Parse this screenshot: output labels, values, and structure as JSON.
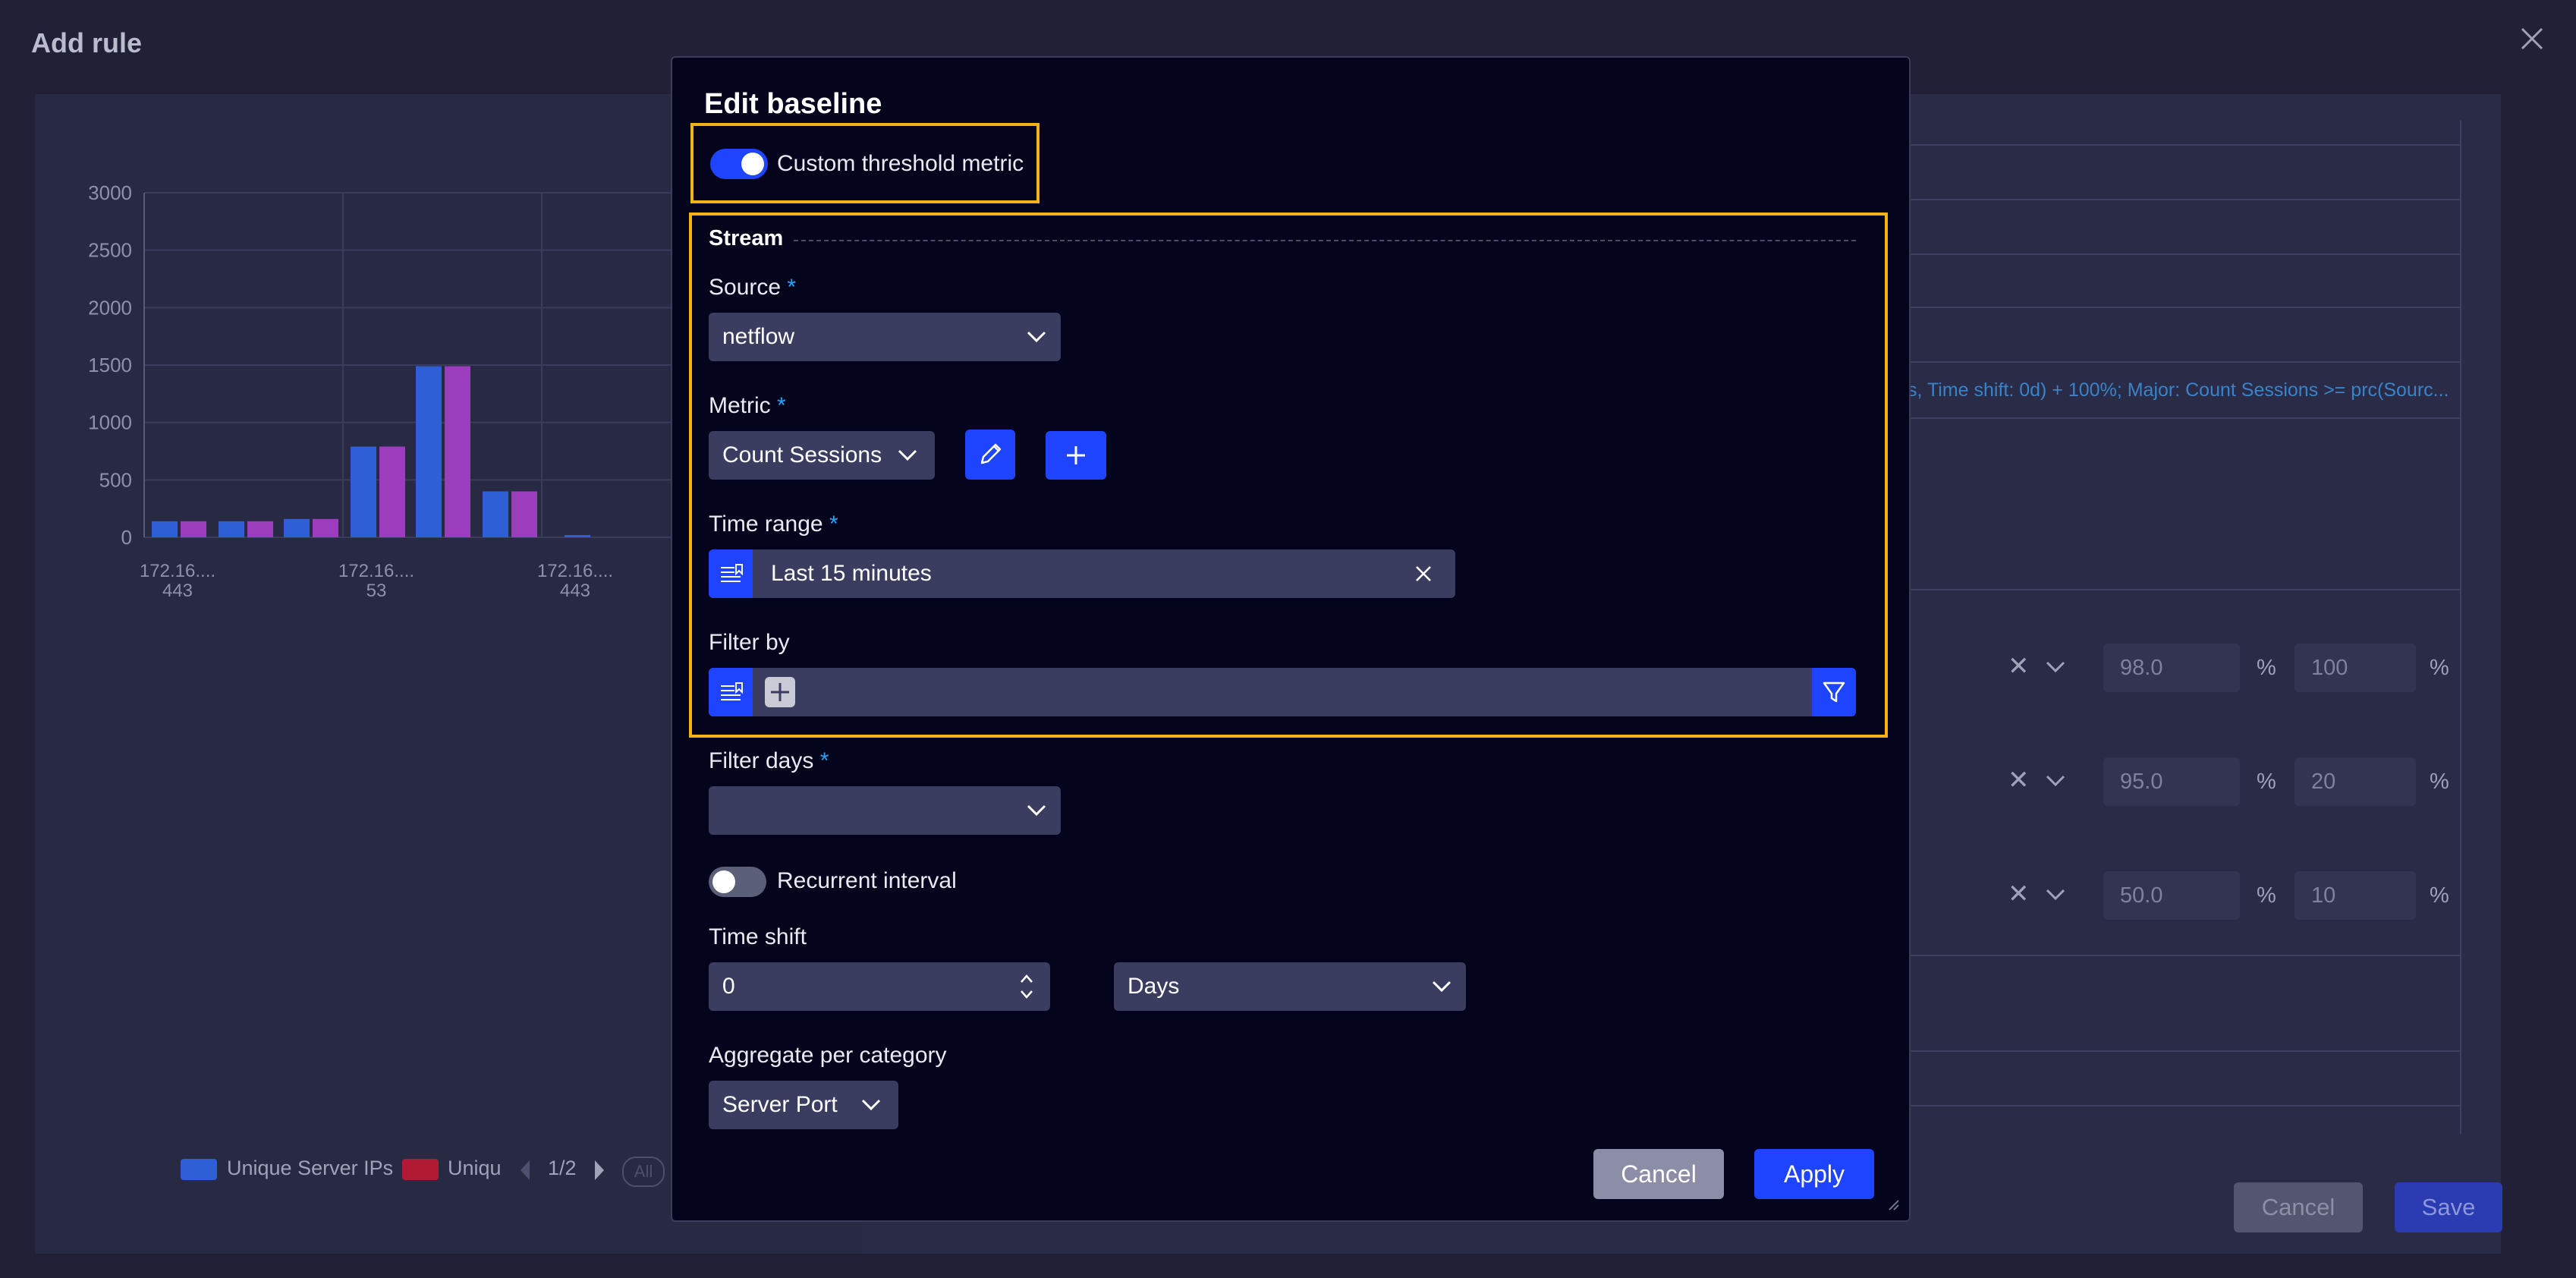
{
  "background": {
    "title": "Add rule",
    "rule_summary": "s, Time shift: 0d) + 100%; Major: Count Sessions >= prc(Sourc...",
    "thresholds": [
      {
        "low": "98.0",
        "high": "100",
        "unit": "%"
      },
      {
        "low": "95.0",
        "high": "20",
        "unit": "%"
      },
      {
        "low": "50.0",
        "high": "10",
        "unit": "%"
      }
    ],
    "cancel_label": "Cancel",
    "save_label": "Save"
  },
  "chart_data": {
    "type": "bar",
    "yticks": [
      "3000",
      "2500",
      "2000",
      "1500",
      "1000",
      "500",
      "0"
    ],
    "xticks": [
      {
        "line1": "172.16....",
        "line2": "443"
      },
      {
        "line1": "172.16....",
        "line2": "53"
      },
      {
        "line1": "172.16....",
        "line2": "443"
      }
    ],
    "ylim": [
      0,
      3000
    ],
    "series": [
      {
        "name": "Unique Server IPs",
        "color": "#2f5fd6",
        "values": [
          140,
          140,
          160,
          790,
          1490,
          400,
          20
        ]
      },
      {
        "name": "Uniqu",
        "color": "#9b3dbd",
        "values": [
          140,
          140,
          160,
          790,
          1490,
          400,
          0
        ]
      }
    ],
    "legend": {
      "items": [
        "Unique Server IPs",
        "Uniqu"
      ],
      "page": "1/2",
      "all_label": "All",
      "colors": [
        "#2f5fd6",
        "#b01a33"
      ]
    }
  },
  "modal": {
    "title": "Edit baseline",
    "custom_threshold_label": "Custom threshold metric",
    "custom_threshold_on": true,
    "stream_label": "Stream",
    "source": {
      "label": "Source",
      "required": "*",
      "value": "netflow"
    },
    "metric": {
      "label": "Metric",
      "required": "*",
      "value": "Count Sessions"
    },
    "time_range": {
      "label": "Time range",
      "required": "*",
      "value": "Last 15 minutes"
    },
    "filter_by": {
      "label": "Filter by"
    },
    "filter_days": {
      "label": "Filter days",
      "required": "*",
      "value": ""
    },
    "recurrent_interval": {
      "label": "Recurrent interval",
      "on": false
    },
    "time_shift": {
      "label": "Time shift",
      "value": "0",
      "unit": "Days"
    },
    "aggregate": {
      "label": "Aggregate per category",
      "value": "Server Port"
    },
    "cancel_label": "Cancel",
    "apply_label": "Apply"
  },
  "colors": {
    "accent": "#1f44ff",
    "highlight": "#f4b315",
    "required": "#21a3ff"
  }
}
